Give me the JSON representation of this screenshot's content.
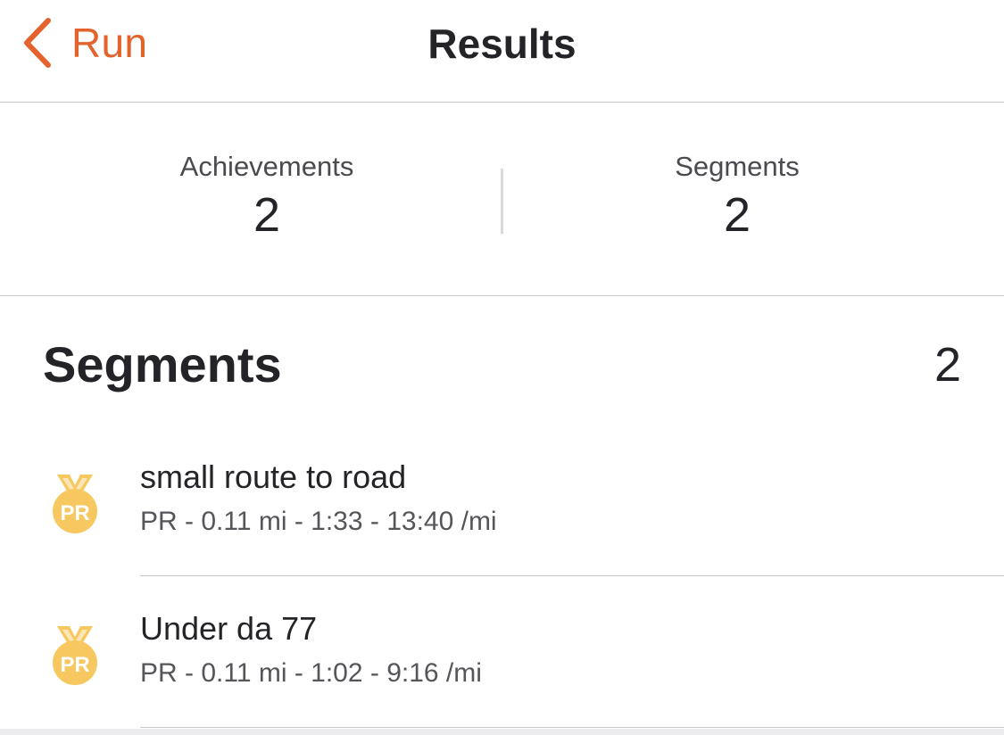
{
  "nav": {
    "back_label": "Run",
    "title": "Results",
    "accent_color": "#e4622b"
  },
  "summary": {
    "achievements": {
      "label": "Achievements",
      "value": "2"
    },
    "segments": {
      "label": "Segments",
      "value": "2"
    }
  },
  "segments_section": {
    "title": "Segments",
    "count": "2",
    "items": [
      {
        "badge": "PR",
        "icon": "pr-medal-icon",
        "name": "small route to road",
        "details": "PR - 0.11 mi - 1:33 - 13:40 /mi"
      },
      {
        "badge": "PR",
        "icon": "pr-medal-icon",
        "name": "Under da 77",
        "details": "PR - 0.11 mi - 1:02 - 9:16 /mi"
      }
    ]
  },
  "colors": {
    "medal_gold": "#f6c85f",
    "medal_text": "#ffffff"
  }
}
